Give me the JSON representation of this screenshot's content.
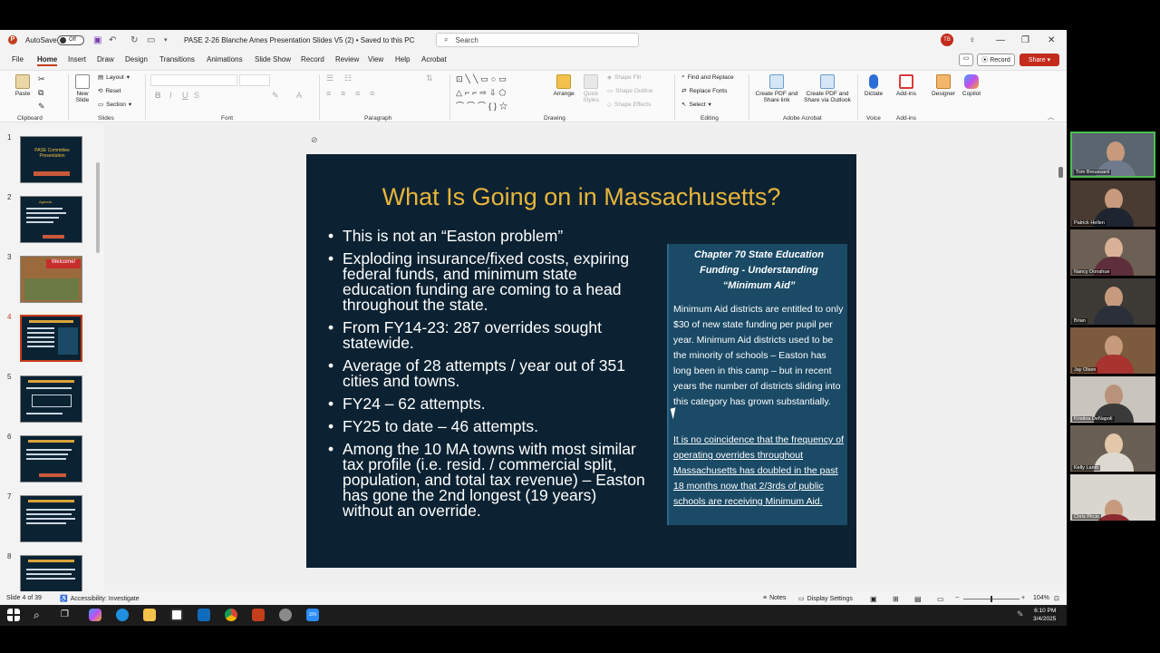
{
  "titlebar": {
    "autosave_label": "AutoSave",
    "autosave_state": "Off",
    "document_title": "PASE 2-26 Blanche Ames Presentation Slides V5 (2) • Saved to this PC",
    "search_placeholder": "Search",
    "user_initials": "TB"
  },
  "menu": {
    "tabs": [
      "File",
      "Home",
      "Insert",
      "Draw",
      "Design",
      "Transitions",
      "Animations",
      "Slide Show",
      "Record",
      "Review",
      "View",
      "Help",
      "Acrobat"
    ],
    "record_label": "Record",
    "share_label": "Share"
  },
  "ribbon": {
    "paste": "Paste",
    "new_slide": "New Slide",
    "layout": "Layout",
    "reset": "Reset",
    "section": "Section",
    "arrange": "Arrange",
    "quick_styles": "Quick Styles",
    "shape_fill": "Shape Fill",
    "shape_outline": "Shape Outline",
    "shape_effects": "Shape Effects",
    "find_replace": "Find and Replace",
    "replace_fonts": "Replace Fonts",
    "select": "Select",
    "create_pdf_share": "Create PDF and Share link",
    "create_pdf_outlook": "Create PDF and Share via Outlook",
    "dictate": "Dictate",
    "addins": "Add-ins",
    "designer": "Designer",
    "copilot": "Copilot",
    "groups": {
      "clipboard": "Clipboard",
      "slides": "Slides",
      "font": "Font",
      "paragraph": "Paragraph",
      "drawing": "Drawing",
      "editing": "Editing",
      "adobe": "Adobe Acrobat",
      "voice": "Voice",
      "addins": "Add-ins"
    }
  },
  "thumbnails": {
    "numbers": [
      "1",
      "2",
      "3",
      "4",
      "5",
      "6",
      "7",
      "8"
    ],
    "slide1_title": "PASE Committee Presentation",
    "slide2_title": "Agenda",
    "slide3_title": "Welcome!"
  },
  "slide": {
    "title": "What Is Going on in Massachusetts?",
    "bullets": [
      "This is not an “Easton problem”",
      "Exploding insurance/fixed costs, expiring federal funds, and minimum state education funding are coming to a head throughout the state.",
      "From FY14-23: 287 overrides sought statewide.",
      "Average of 28 attempts / year out of 351 cities and towns.",
      "FY24 – 62 attempts.",
      "FY25 to date – 46 attempts.",
      "Among the 10 MA towns with most similar tax profile (i.e. resid. / commercial split, population, and total tax revenue) – Easton has gone the 2nd longest (19 years) without an override."
    ],
    "sidebox_title": "Chapter 70 State Education Funding - Understanding “Minimum Aid”",
    "sidebox_p1": "Minimum Aid districts are entitled to only $30 of new state funding per pupil per year. Minimum Aid districts used to be the minority of schools – Easton has long been in this camp – but in recent years the number of districts sliding into this category has grown substantially.",
    "sidebox_p2": "It is no coincidence that the frequency of operating overrides throughout Massachusetts has doubled in the past 18 months now that 2/3rds of public schools are receiving Minimum Aid."
  },
  "statusbar": {
    "slide_count": "Slide 4 of 39",
    "accessibility": "Accessibility: Investigate",
    "notes": "Notes",
    "display_settings": "Display Settings",
    "zoom": "104%"
  },
  "taskbar": {
    "time": "6:10 PM",
    "date": "3/4/2025"
  },
  "participants": [
    "Tom Broussard",
    "Patrick Hellen",
    "Nancy Donahue",
    "Brian",
    "Jay Olsen",
    "Kristina DeNapoli",
    "Kelly Lamb",
    "Chris Pircio"
  ],
  "colors": {
    "slide_bg": "#0c2232",
    "title_gold": "#e8b53a",
    "sidebox_bg": "#1a4a66",
    "accent_red": "#c43e1c"
  }
}
